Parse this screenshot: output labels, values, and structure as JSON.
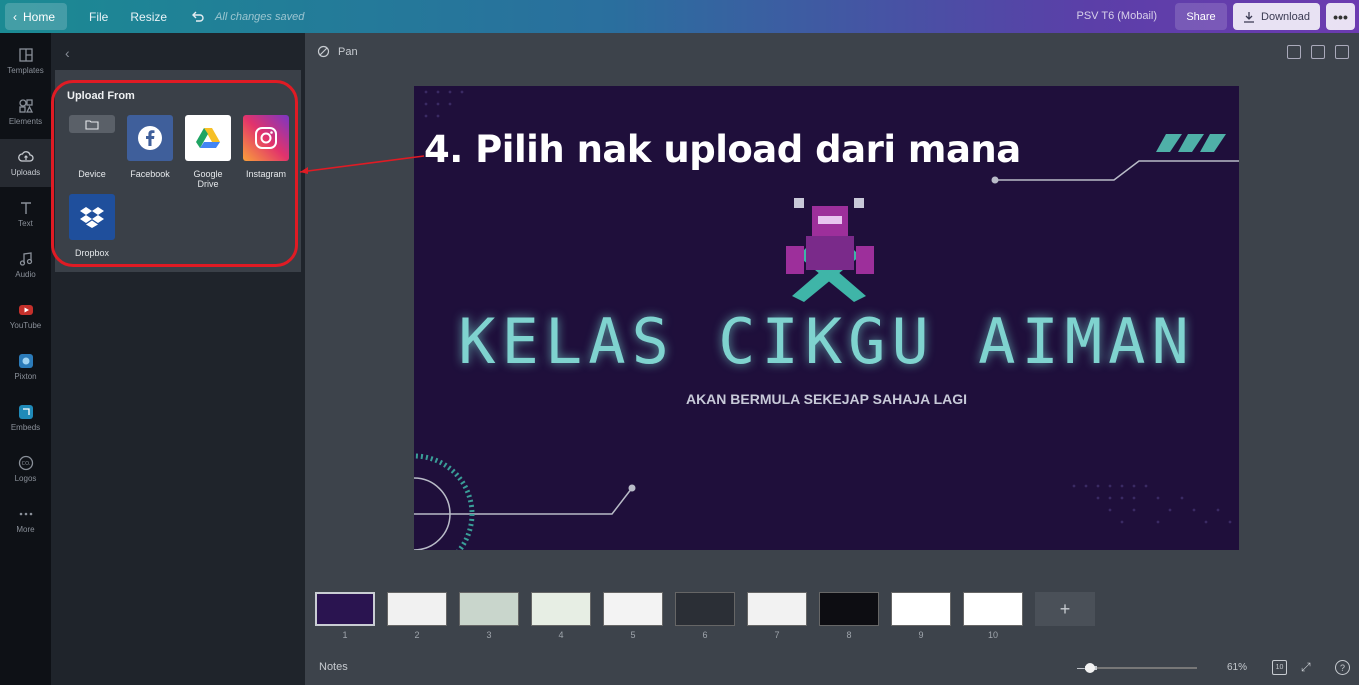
{
  "topbar": {
    "home": "Home",
    "file": "File",
    "resize": "Resize",
    "saved_status": "All changes saved",
    "doc_title": "PSV T6 (Mobail)",
    "share": "Share",
    "download": "Download",
    "more": "•••"
  },
  "rail": [
    {
      "label": "Templates",
      "icon": "templates-icon"
    },
    {
      "label": "Elements",
      "icon": "elements-icon"
    },
    {
      "label": "Uploads",
      "icon": "uploads-icon"
    },
    {
      "label": "Text",
      "icon": "text-icon"
    },
    {
      "label": "Audio",
      "icon": "audio-icon"
    },
    {
      "label": "YouTube",
      "icon": "youtube-icon"
    },
    {
      "label": "Pixton",
      "icon": "pixton-icon"
    },
    {
      "label": "Embeds",
      "icon": "embeds-icon"
    },
    {
      "label": "Logos",
      "icon": "logos-icon"
    },
    {
      "label": "More",
      "icon": "more-icon"
    }
  ],
  "upload_panel": {
    "title": "Upload From",
    "sources": [
      {
        "label": "Device",
        "icon": "folder-icon"
      },
      {
        "label": "Facebook",
        "icon": "facebook-icon"
      },
      {
        "label": "Google Drive",
        "icon": "google-drive-icon"
      },
      {
        "label": "Instagram",
        "icon": "instagram-icon"
      },
      {
        "label": "Dropbox",
        "icon": "dropbox-icon"
      }
    ]
  },
  "workspace": {
    "pan": "Pan",
    "callout": "4. Pilih nak upload dari mana"
  },
  "slide": {
    "title": "KELAS CIKGU AIMAN",
    "subtitle": "AKAN BERMULA SEKEJAP SAHAJA LAGI"
  },
  "filmstrip": {
    "pages": [
      "1",
      "2",
      "3",
      "4",
      "5",
      "6",
      "7",
      "8",
      "9",
      "10"
    ],
    "add": "+"
  },
  "footer": {
    "notes": "Notes",
    "zoom": "61%",
    "page_count": "10",
    "help": "?"
  },
  "colors": {
    "accent_red": "#e01b24",
    "slide_bg": "#1f0f3b",
    "glow_teal": "#7fd3cf"
  }
}
